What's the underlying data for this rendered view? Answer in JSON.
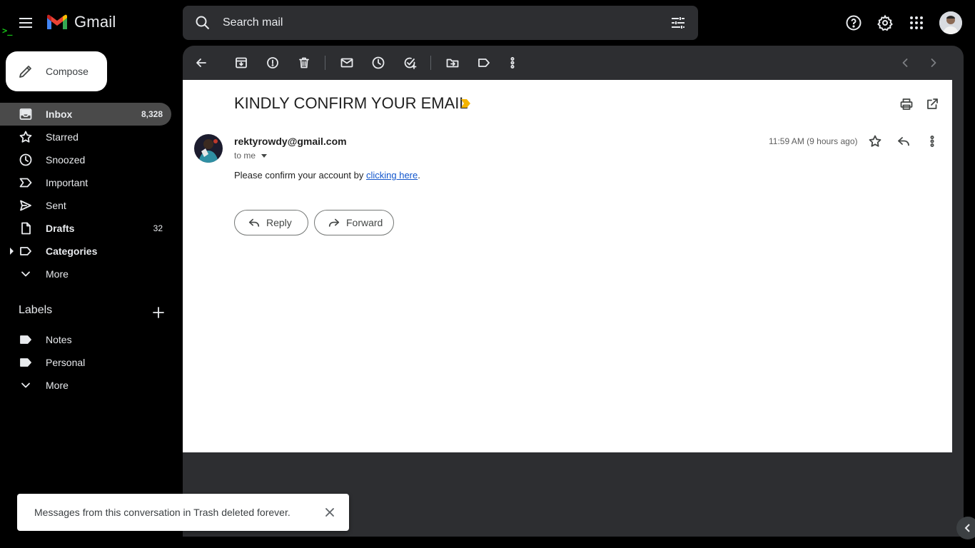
{
  "app": {
    "name": "Gmail",
    "terminal_mark": ">_"
  },
  "search": {
    "placeholder": "Search mail"
  },
  "sidebar": {
    "compose_label": "Compose",
    "items": [
      {
        "label": "Inbox",
        "count": "8,328",
        "icon": "inbox-icon",
        "active": true
      },
      {
        "label": "Starred",
        "count": "",
        "icon": "star-icon"
      },
      {
        "label": "Snoozed",
        "count": "",
        "icon": "clock-icon"
      },
      {
        "label": "Important",
        "count": "",
        "icon": "important-icon"
      },
      {
        "label": "Sent",
        "count": "",
        "icon": "send-icon"
      },
      {
        "label": "Drafts",
        "count": "32",
        "icon": "draft-icon"
      },
      {
        "label": "Categories",
        "count": "",
        "icon": "label-icon"
      },
      {
        "label": "More",
        "count": "",
        "icon": "chevron-down-icon"
      }
    ],
    "labels_title": "Labels",
    "labels": [
      {
        "label": "Notes",
        "icon": "label-filled-icon"
      },
      {
        "label": "Personal",
        "icon": "label-filled-icon"
      },
      {
        "label": "More",
        "icon": "chevron-down-icon"
      }
    ]
  },
  "email": {
    "subject": "KINDLY CONFIRM YOUR EMAIL",
    "sender": "rektyrowdy@gmail.com",
    "recipient": "to me",
    "time": "11:59 AM (9 hours ago)",
    "body_prefix": "Please confirm your account by ",
    "body_link": "clicking here",
    "body_suffix": ".",
    "reply_label": "Reply",
    "forward_label": "Forward"
  },
  "toast": {
    "message": "Messages from this conversation in Trash deleted forever."
  },
  "colors": {
    "accent_important": "#f4b400",
    "link": "#1155cc",
    "active_nav": "#4a4a4a"
  }
}
